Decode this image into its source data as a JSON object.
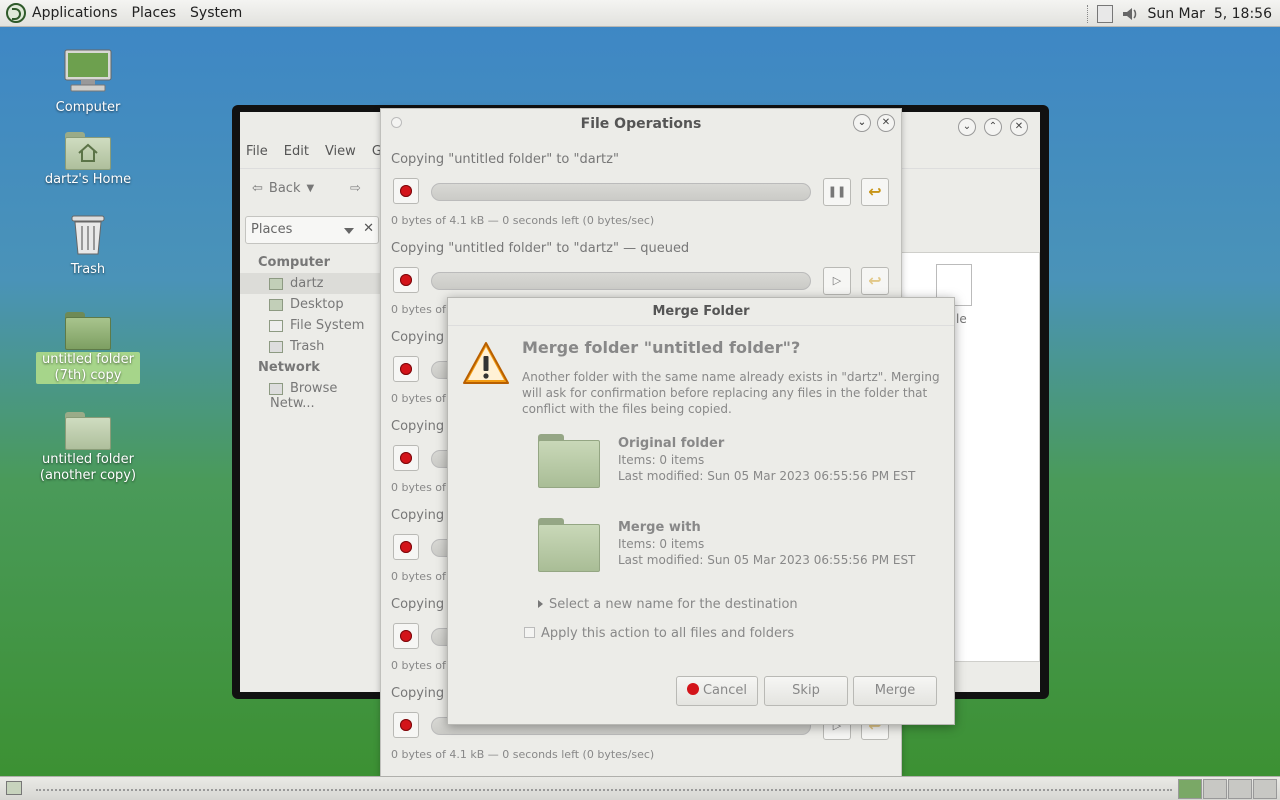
{
  "top_panel": {
    "menus": [
      "Applications",
      "Places",
      "System"
    ],
    "clock": "Sun Mar  5, 18:56"
  },
  "desktop_icons": [
    {
      "label": "Computer",
      "icon": "computer-icon"
    },
    {
      "label": "dartz's Home",
      "icon": "home-folder-icon"
    },
    {
      "label": "Trash",
      "icon": "trash-icon"
    },
    {
      "label": "untitled folder (7th) copy",
      "icon": "folder-icon",
      "selected": true
    },
    {
      "label": "untitled folder (another copy)",
      "icon": "folder-icon"
    }
  ],
  "file_manager": {
    "menus": [
      "File",
      "Edit",
      "View",
      "Go"
    ],
    "back_label": "Back",
    "places_label": "Places",
    "sidebar": {
      "computer_header": "Computer",
      "computer_items": [
        "dartz",
        "Desktop",
        "File System",
        "Trash"
      ],
      "network_header": "Network",
      "network_items": [
        "Browse Netw..."
      ]
    },
    "partial_file_label": "le"
  },
  "file_operations": {
    "title": "File Operations",
    "operations": [
      {
        "label": "Copying \"untitled folder\" to \"dartz\"",
        "status": "0 bytes of 4.1 kB — 0 seconds left (0 bytes/sec)",
        "progress": 0
      },
      {
        "label": "Copying \"untitled folder\" to \"dartz\" — queued",
        "status": "0 bytes of 4",
        "progress": 0
      },
      {
        "label": "Copying \"",
        "status": "0 bytes of 4",
        "progress": 0
      },
      {
        "label": "Copying \"",
        "status": "0 bytes of 4",
        "progress": 0
      },
      {
        "label": "Copying \"",
        "status": "0 bytes of 4",
        "progress": 0
      },
      {
        "label": "Copying \"",
        "status": "0 bytes of 4",
        "progress": 0
      },
      {
        "label": "Copying \"",
        "status": "0 bytes of 4.1 kB — 0 seconds left (0 bytes/sec)",
        "progress": 0
      }
    ]
  },
  "merge_dialog": {
    "title": "Merge Folder",
    "heading": "Merge folder \"untitled folder\"?",
    "body": "Another folder with the same name already exists in \"dartz\". Merging will ask for confirmation before replacing any files in the folder that conflict with the files being copied.",
    "original": {
      "name": "Original folder",
      "items": "Items: 0 items",
      "modified": "Last modified: Sun 05 Mar 2023 06:55:56 PM EST"
    },
    "merge_with": {
      "name": "Merge with",
      "items": "Items: 0 items",
      "modified": "Last modified: Sun 05 Mar 2023 06:55:56 PM EST"
    },
    "expander": "Select a new name for the destination",
    "apply_all": "Apply this action to all files and folders",
    "buttons": {
      "cancel": "Cancel",
      "skip": "Skip",
      "merge": "Merge"
    }
  }
}
